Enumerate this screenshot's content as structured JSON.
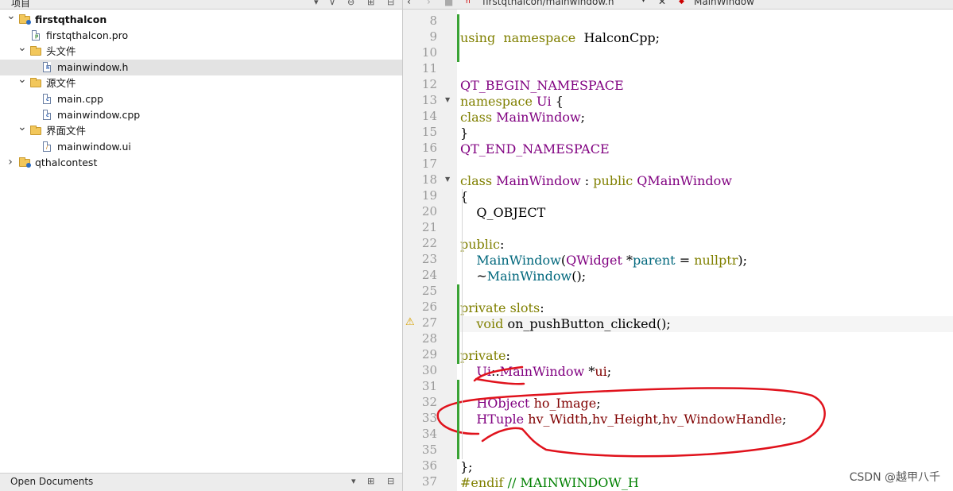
{
  "left_panel": {
    "title": "项目",
    "tree": [
      {
        "label": "firstqthalcon",
        "arrow": "v",
        "bold": true,
        "indent": 0,
        "icon": "project-folder-icon"
      },
      {
        "label": "firstqthalcon.pro",
        "arrow": "",
        "bold": false,
        "indent": 1,
        "icon": "pro-file-icon"
      },
      {
        "label": "头文件",
        "arrow": "v",
        "bold": false,
        "indent": 1,
        "icon": "header-folder-icon"
      },
      {
        "label": "mainwindow.h",
        "arrow": "",
        "bold": false,
        "indent": 2,
        "icon": "header-file-icon",
        "selected": true
      },
      {
        "label": "源文件",
        "arrow": "v",
        "bold": false,
        "indent": 1,
        "icon": "source-folder-icon"
      },
      {
        "label": "main.cpp",
        "arrow": "",
        "bold": false,
        "indent": 2,
        "icon": "cpp-file-icon"
      },
      {
        "label": "mainwindow.cpp",
        "arrow": "",
        "bold": false,
        "indent": 2,
        "icon": "cpp-file-icon"
      },
      {
        "label": "界面文件",
        "arrow": "v",
        "bold": false,
        "indent": 1,
        "icon": "form-folder-icon"
      },
      {
        "label": "mainwindow.ui",
        "arrow": "",
        "bold": false,
        "indent": 2,
        "icon": "ui-file-icon"
      },
      {
        "label": "qthalcontest",
        "arrow": ">",
        "bold": false,
        "indent": 0,
        "icon": "project-folder-icon"
      }
    ],
    "footer_title": "Open Documents"
  },
  "editor": {
    "file_tab": "firstqthalcon/mainwindow.h",
    "symbol": "MainWindow",
    "lines": [
      {
        "n": "8",
        "tokens": []
      },
      {
        "n": "9",
        "tokens": [
          [
            "kw",
            "using"
          ],
          [
            "",
            "  "
          ],
          [
            "kw",
            "namespace"
          ],
          [
            "",
            "  HalconCpp;"
          ]
        ]
      },
      {
        "n": "10",
        "tokens": []
      },
      {
        "n": "11",
        "tokens": []
      },
      {
        "n": "12",
        "tokens": [
          [
            "mac",
            "QT_BEGIN_NAMESPACE"
          ]
        ]
      },
      {
        "n": "13",
        "tokens": [
          [
            "kw",
            "namespace"
          ],
          [
            "",
            " "
          ],
          [
            "tp",
            "Ui"
          ],
          [
            "",
            " {"
          ]
        ]
      },
      {
        "n": "14",
        "tokens": [
          [
            "kw",
            "class"
          ],
          [
            "",
            " "
          ],
          [
            "tp",
            "MainWindow"
          ],
          [
            "",
            ";"
          ]
        ]
      },
      {
        "n": "15",
        "tokens": [
          [
            "",
            "}"
          ]
        ]
      },
      {
        "n": "16",
        "tokens": [
          [
            "mac",
            "QT_END_NAMESPACE"
          ]
        ]
      },
      {
        "n": "17",
        "tokens": []
      },
      {
        "n": "18",
        "tokens": [
          [
            "kw",
            "class"
          ],
          [
            "",
            " "
          ],
          [
            "tp",
            "MainWindow"
          ],
          [
            "",
            " : "
          ],
          [
            "kw",
            "public"
          ],
          [
            "",
            " "
          ],
          [
            "tp",
            "QMainWindow"
          ]
        ]
      },
      {
        "n": "19",
        "tokens": [
          [
            "",
            "{"
          ]
        ]
      },
      {
        "n": "20",
        "tokens": [
          [
            "",
            "    Q_OBJECT"
          ]
        ]
      },
      {
        "n": "21",
        "tokens": []
      },
      {
        "n": "22",
        "tokens": [
          [
            "kw",
            "public"
          ],
          [
            "",
            ":"
          ]
        ]
      },
      {
        "n": "23",
        "tokens": [
          [
            "",
            "    "
          ],
          [
            "fn",
            "MainWindow"
          ],
          [
            "",
            "("
          ],
          [
            "tp",
            "QWidget"
          ],
          [
            "",
            " *"
          ],
          [
            "fn",
            "parent"
          ],
          [
            "",
            " = "
          ],
          [
            "kw",
            "nullptr"
          ],
          [
            "",
            ");"
          ]
        ]
      },
      {
        "n": "24",
        "tokens": [
          [
            "",
            "    ~"
          ],
          [
            "fn",
            "MainWindow"
          ],
          [
            "",
            "();"
          ]
        ]
      },
      {
        "n": "25",
        "tokens": []
      },
      {
        "n": "26",
        "tokens": [
          [
            "kw",
            "private"
          ],
          [
            "",
            " "
          ],
          [
            "kw",
            "slots"
          ],
          [
            "",
            ":"
          ]
        ]
      },
      {
        "n": "27",
        "tokens": [
          [
            "",
            "    "
          ],
          [
            "kw",
            "void"
          ],
          [
            "",
            " on_pushButton_clicked();"
          ]
        ]
      },
      {
        "n": "28",
        "tokens": []
      },
      {
        "n": "29",
        "tokens": [
          [
            "kw",
            "private"
          ],
          [
            "",
            ":"
          ]
        ]
      },
      {
        "n": "30",
        "tokens": [
          [
            "",
            "    "
          ],
          [
            "tp",
            "Ui"
          ],
          [
            "",
            "::"
          ],
          [
            "tp",
            "MainWindow"
          ],
          [
            "",
            " *"
          ],
          [
            "fd",
            "ui"
          ],
          [
            "",
            ";"
          ]
        ]
      },
      {
        "n": "31",
        "tokens": []
      },
      {
        "n": "32",
        "tokens": [
          [
            "",
            "    "
          ],
          [
            "tp",
            "HObject"
          ],
          [
            "",
            " "
          ],
          [
            "fd",
            "ho_Image"
          ],
          [
            "",
            ";"
          ]
        ]
      },
      {
        "n": "33",
        "tokens": [
          [
            "",
            "    "
          ],
          [
            "tp",
            "HTuple"
          ],
          [
            "",
            " "
          ],
          [
            "fd",
            "hv_Width"
          ],
          [
            "",
            ","
          ],
          [
            "fd",
            "hv_Height"
          ],
          [
            "",
            ","
          ],
          [
            "fd",
            "hv_WindowHandle"
          ],
          [
            "",
            ";"
          ]
        ]
      },
      {
        "n": "34",
        "tokens": []
      },
      {
        "n": "35",
        "tokens": []
      },
      {
        "n": "36",
        "tokens": [
          [
            "",
            "};"
          ]
        ]
      },
      {
        "n": "37",
        "tokens": [
          [
            "pr",
            "#endif"
          ],
          [
            "",
            " "
          ],
          [
            "cm",
            "// MAINWINDOW_H"
          ]
        ]
      }
    ]
  },
  "watermark": "CSDN @越甲八千",
  "colors": {
    "keyword": "#808000",
    "type": "#800080",
    "field": "#800000",
    "comment": "#008000",
    "annotation": "#e0121c",
    "change_marker": "#3aa335"
  }
}
